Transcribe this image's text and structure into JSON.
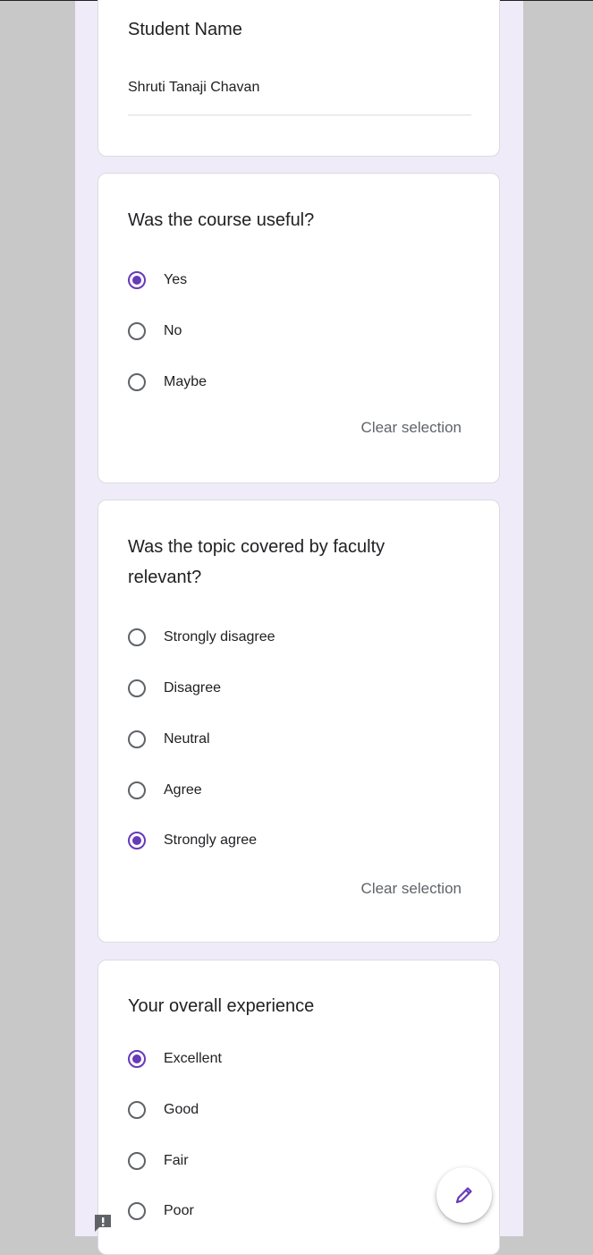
{
  "student_name": {
    "label": "Student Name",
    "value": "Shruti Tanaji Chavan"
  },
  "question_1": {
    "title": "Was the course useful?",
    "options": [
      "Yes",
      "No",
      "Maybe"
    ],
    "selected": "Yes",
    "clear_label": "Clear selection"
  },
  "question_2": {
    "title_line1": "Was the topic covered by faculty",
    "title_line2": "relevant?",
    "options": [
      "Strongly disagree",
      "Disagree",
      "Neutral",
      "Agree",
      "Strongly agree"
    ],
    "selected": "Strongly agree",
    "clear_label": "Clear selection"
  },
  "question_3": {
    "title": "Your overall experience",
    "options": [
      "Excellent",
      "Good",
      "Fair",
      "Poor"
    ],
    "selected": "Excellent"
  },
  "colors": {
    "accent": "#673ab7",
    "background": "#f0ebf8",
    "card": "#ffffff"
  },
  "icons": {
    "edit": "pencil-icon",
    "report": "report-icon"
  }
}
